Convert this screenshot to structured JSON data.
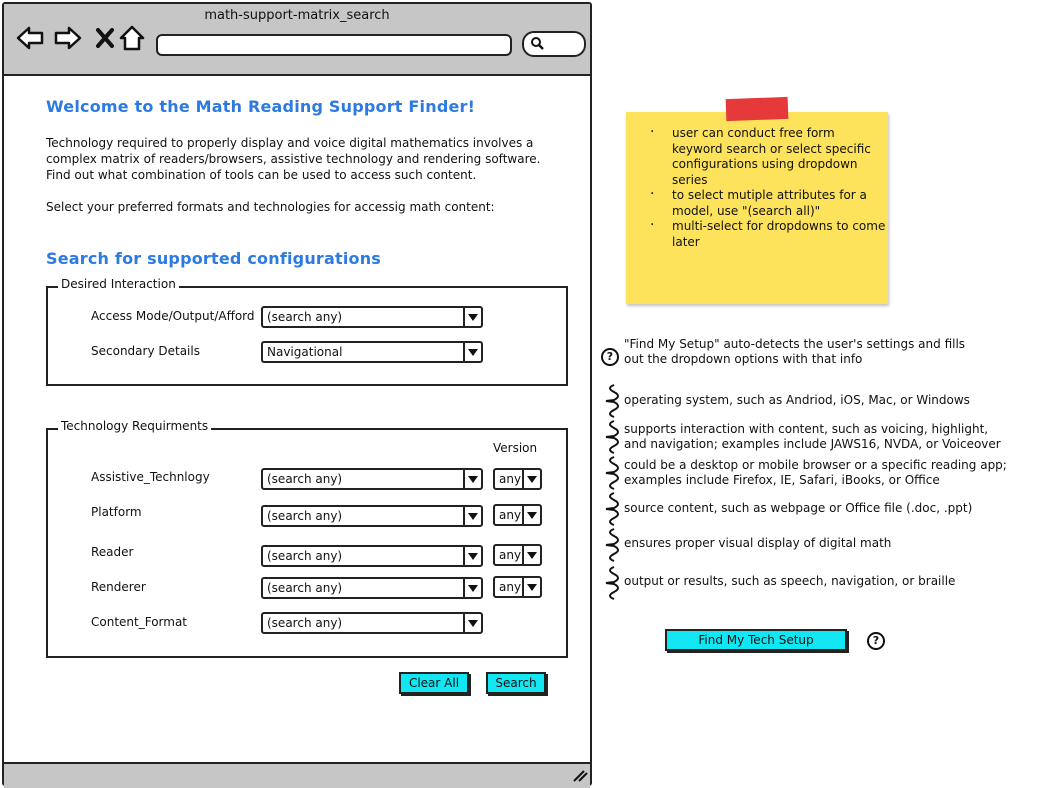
{
  "window": {
    "title": "math-support-matrix_search",
    "url_value": "",
    "search_value": ""
  },
  "page": {
    "heading": "Welcome to the Math Reading Support Finder!",
    "intro": "Technology required to properly display and voice digital mathematics involves a complex matrix of readers/browsers, assistive technology and rendering software. Find out what combination of tools can be used to access such content.",
    "instruction": "Select your preferred formats and technologies for accessig math content:",
    "search_heading": "Search for supported configurations"
  },
  "desired_interaction": {
    "legend": "Desired Interaction",
    "rows": [
      {
        "label": "Access Mode/Output/Afford",
        "value": "(search any)"
      },
      {
        "label": "Secondary Details",
        "value": "Navigational"
      }
    ]
  },
  "technology": {
    "legend": "Technology Requirments",
    "version_header": "Version",
    "rows": [
      {
        "label": "Assistive_Technlogy",
        "value": "(search any)",
        "version": "any"
      },
      {
        "label": "Platform",
        "value": "(search any)",
        "version": "any"
      },
      {
        "label": "Reader",
        "value": "(search any)",
        "version": "any"
      },
      {
        "label": "Renderer",
        "value": "(search any)",
        "version": "any"
      },
      {
        "label": "Content_Format",
        "value": "(search any)"
      }
    ]
  },
  "actions": {
    "clear_all": "Clear All",
    "search": "Search",
    "find_setup": "Find My Tech Setup"
  },
  "sticky": {
    "items": [
      "user can conduct free form keyword search or select specific configurations using dropdown series",
      "to select mutiple attributes for a model, use \"(search all)\"",
      "multi-select for dropdowns to come later"
    ]
  },
  "annotations": {
    "find_setup_note": "\"Find My Setup\" auto-detects the user's settings and fills out the dropdown options with that info",
    "access_mode": "operating system, such as Andriod, iOS, Mac, or Windows",
    "assistive_tech": "supports interaction with content, such as voicing, highlight, and navigation; examples include JAWS16, NVDA, or Voiceover",
    "reader": "could be a desktop or mobile browser or a specific reading app; examples include Firefox, IE, Safari, iBooks, or Office",
    "content_format": "source content, such as webpage or Office file (.doc, .ppt)",
    "renderer": "ensures proper visual display of digital math",
    "output": "output or results, such as speech, navigation, or braille"
  },
  "colors": {
    "heading": "#2d7be0",
    "button": "#12e6f2",
    "sticky": "#fde25c",
    "tape": "#e63a3a",
    "chrome": "#c6c6c6"
  },
  "icons": [
    "back-arrow-icon",
    "forward-arrow-icon",
    "close-icon",
    "home-icon",
    "search-icon",
    "help-icon",
    "resize-grip-icon",
    "chevron-down-icon",
    "squiggle-brace-icon"
  ]
}
